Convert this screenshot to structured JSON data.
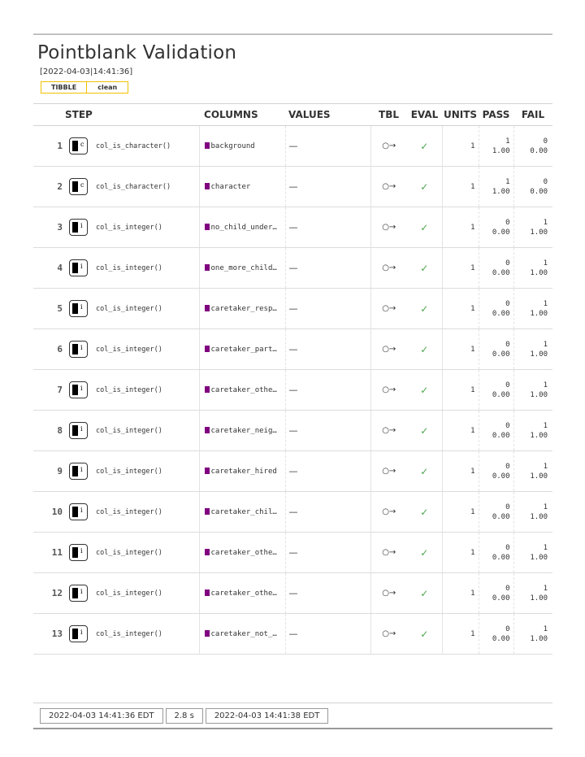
{
  "report": {
    "title": "Pointblank Validation",
    "timestamp": "[2022-04-03|14:41:36]",
    "tags": [
      "TIBBLE",
      "clean"
    ]
  },
  "headers": {
    "step": "STEP",
    "columns": "COLUMNS",
    "values": "VALUES",
    "tbl": "TBL",
    "eval": "EVAL",
    "units": "UNITS",
    "pass": "PASS",
    "fail": "FAIL"
  },
  "rows": [
    {
      "n": "1",
      "ch": "c",
      "fn": "col_is_character()",
      "col": "background",
      "val": "—",
      "tbl": "○→",
      "ev": "✓",
      "units": "1",
      "pass": "1",
      "pass_frac": "1.00",
      "fail": "0",
      "fail_frac": "0.00"
    },
    {
      "n": "2",
      "ch": "c",
      "fn": "col_is_character()",
      "col": "character",
      "val": "—",
      "tbl": "○→",
      "ev": "✓",
      "units": "1",
      "pass": "1",
      "pass_frac": "1.00",
      "fail": "0",
      "fail_frac": "0.00"
    },
    {
      "n": "3",
      "ch": "i",
      "fn": "col_is_integer()",
      "col": "no_child_under…",
      "val": "—",
      "tbl": "○→",
      "ev": "✓",
      "units": "1",
      "pass": "0",
      "pass_frac": "0.00",
      "fail": "1",
      "fail_frac": "1.00"
    },
    {
      "n": "4",
      "ch": "i",
      "fn": "col_is_integer()",
      "col": "one_more_child…",
      "val": "—",
      "tbl": "○→",
      "ev": "✓",
      "units": "1",
      "pass": "0",
      "pass_frac": "0.00",
      "fail": "1",
      "fail_frac": "1.00"
    },
    {
      "n": "5",
      "ch": "i",
      "fn": "col_is_integer()",
      "col": "caretaker_resp…",
      "val": "—",
      "tbl": "○→",
      "ev": "✓",
      "units": "1",
      "pass": "0",
      "pass_frac": "0.00",
      "fail": "1",
      "fail_frac": "1.00"
    },
    {
      "n": "6",
      "ch": "i",
      "fn": "col_is_integer()",
      "col": "caretaker_part…",
      "val": "—",
      "tbl": "○→",
      "ev": "✓",
      "units": "1",
      "pass": "0",
      "pass_frac": "0.00",
      "fail": "1",
      "fail_frac": "1.00"
    },
    {
      "n": "7",
      "ch": "i",
      "fn": "col_is_integer()",
      "col": "caretaker_othe…",
      "val": "—",
      "tbl": "○→",
      "ev": "✓",
      "units": "1",
      "pass": "0",
      "pass_frac": "0.00",
      "fail": "1",
      "fail_frac": "1.00"
    },
    {
      "n": "8",
      "ch": "i",
      "fn": "col_is_integer()",
      "col": "caretaker_neig…",
      "val": "—",
      "tbl": "○→",
      "ev": "✓",
      "units": "1",
      "pass": "0",
      "pass_frac": "0.00",
      "fail": "1",
      "fail_frac": "1.00"
    },
    {
      "n": "9",
      "ch": "i",
      "fn": "col_is_integer()",
      "col": "caretaker_hired",
      "val": "—",
      "tbl": "○→",
      "ev": "✓",
      "units": "1",
      "pass": "0",
      "pass_frac": "0.00",
      "fail": "1",
      "fail_frac": "1.00"
    },
    {
      "n": "10",
      "ch": "i",
      "fn": "col_is_integer()",
      "col": "caretaker_chil…",
      "val": "—",
      "tbl": "○→",
      "ev": "✓",
      "units": "1",
      "pass": "0",
      "pass_frac": "0.00",
      "fail": "1",
      "fail_frac": "1.00"
    },
    {
      "n": "11",
      "ch": "i",
      "fn": "col_is_integer()",
      "col": "caretaker_othe…",
      "val": "—",
      "tbl": "○→",
      "ev": "✓",
      "units": "1",
      "pass": "0",
      "pass_frac": "0.00",
      "fail": "1",
      "fail_frac": "1.00"
    },
    {
      "n": "12",
      "ch": "i",
      "fn": "col_is_integer()",
      "col": "caretaker_othe…",
      "val": "—",
      "tbl": "○→",
      "ev": "✓",
      "units": "1",
      "pass": "0",
      "pass_frac": "0.00",
      "fail": "1",
      "fail_frac": "1.00"
    },
    {
      "n": "13",
      "ch": "i",
      "fn": "col_is_integer()",
      "col": "caretaker_not_…",
      "val": "—",
      "tbl": "○→",
      "ev": "✓",
      "units": "1",
      "pass": "0",
      "pass_frac": "0.00",
      "fail": "1",
      "fail_frac": "1.00"
    }
  ],
  "footer": {
    "start_time": "2022-04-03 14:41:36 EDT",
    "duration": "2.8 s",
    "end_time": "2022-04-03 14:41:38 EDT"
  },
  "colors": {
    "column_marker": "#800080",
    "eval_pass": "#4ca64c",
    "tag_border": "#f0c000"
  }
}
